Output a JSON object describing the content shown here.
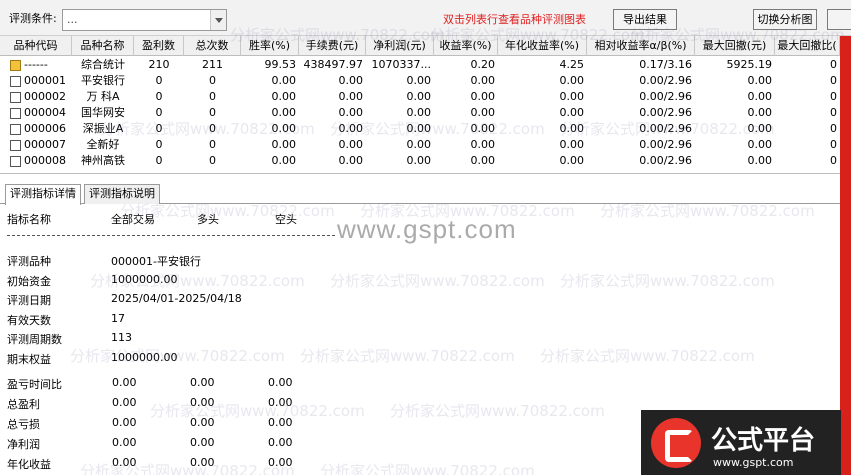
{
  "toolbar": {
    "condition_label": "评测条件:",
    "condition_value": "...",
    "hint": "双击列表行查看品种评测图表",
    "export_label": "导出结果",
    "switch_label": "切换分析图"
  },
  "grid": {
    "columns": [
      "品种代码",
      "品种名称",
      "盈利数",
      "总次数",
      "胜率(%)",
      "手续费(元)",
      "净利润(元)",
      "收益率(%)",
      "年化收益率(%)",
      "相对收益率α/β(%)",
      "最大回撤(元)",
      "最大回撤比("
    ],
    "rows": [
      {
        "code": "------",
        "name": "综合统计",
        "wins": "210",
        "total": "211",
        "winrate": "99.53",
        "fee": "438497.97",
        "net": "1070337...",
        "ret": "0.20",
        "annual": "4.25",
        "relative": "0.17/3.16",
        "maxdd": "5925.19",
        "maxddr": "0"
      },
      {
        "code": "000001",
        "name": "平安银行",
        "wins": "0",
        "total": "0",
        "winrate": "0.00",
        "fee": "0.00",
        "net": "0.00",
        "ret": "0.00",
        "annual": "0.00",
        "relative": "0.00/2.96",
        "maxdd": "0.00",
        "maxddr": "0"
      },
      {
        "code": "000002",
        "name": "万 科A",
        "wins": "0",
        "total": "0",
        "winrate": "0.00",
        "fee": "0.00",
        "net": "0.00",
        "ret": "0.00",
        "annual": "0.00",
        "relative": "0.00/2.96",
        "maxdd": "0.00",
        "maxddr": "0"
      },
      {
        "code": "000004",
        "name": "国华网安",
        "wins": "0",
        "total": "0",
        "winrate": "0.00",
        "fee": "0.00",
        "net": "0.00",
        "ret": "0.00",
        "annual": "0.00",
        "relative": "0.00/2.96",
        "maxdd": "0.00",
        "maxddr": "0"
      },
      {
        "code": "000006",
        "name": "深振业A",
        "wins": "0",
        "total": "0",
        "winrate": "0.00",
        "fee": "0.00",
        "net": "0.00",
        "ret": "0.00",
        "annual": "0.00",
        "relative": "0.00/2.96",
        "maxdd": "0.00",
        "maxddr": "0"
      },
      {
        "code": "000007",
        "name": "全新好",
        "wins": "0",
        "total": "0",
        "winrate": "0.00",
        "fee": "0.00",
        "net": "0.00",
        "ret": "0.00",
        "annual": "0.00",
        "relative": "0.00/2.96",
        "maxdd": "0.00",
        "maxddr": "0"
      },
      {
        "code": "000008",
        "name": "神州高铁",
        "wins": "0",
        "total": "0",
        "winrate": "0.00",
        "fee": "0.00",
        "net": "0.00",
        "ret": "0.00",
        "annual": "0.00",
        "relative": "0.00/2.96",
        "maxdd": "0.00",
        "maxddr": "0"
      }
    ]
  },
  "tabs": [
    "评测指标详情",
    "评测指标说明"
  ],
  "detail": {
    "header": [
      "指标名称",
      "全部交易",
      "多头",
      "空头"
    ],
    "items": [
      {
        "label": "评测品种",
        "value": "000001-平安银行"
      },
      {
        "label": "初始资金",
        "value": "1000000.00"
      },
      {
        "label": "评测日期",
        "value": "2025/04/01-2025/04/18"
      },
      {
        "label": "有效天数",
        "value": "17"
      },
      {
        "label": "评测周期数",
        "value": "113"
      },
      {
        "label": "期末权益",
        "value": "1000000.00"
      }
    ],
    "triples": [
      {
        "label": "盈亏时间比",
        "all": "0.00",
        "long": "0.00",
        "short": "0.00"
      },
      {
        "label": "总盈利",
        "all": "0.00",
        "long": "0.00",
        "short": "0.00"
      },
      {
        "label": "总亏损",
        "all": "0.00",
        "long": "0.00",
        "short": "0.00"
      },
      {
        "label": "净利润",
        "all": "0.00",
        "long": "0.00",
        "short": "0.00"
      },
      {
        "label": "年化收益",
        "all": "0.00",
        "long": "0.00",
        "short": "0.00"
      }
    ]
  },
  "watermarks": {
    "main": "www.gspt.com",
    "repeat": "分析家公式网www.70822.com"
  },
  "logo": {
    "title": "公式平台",
    "url": "www.gspt.com"
  },
  "colors": {
    "accent_red": "#d9211c",
    "hint_red": "#e02020"
  }
}
